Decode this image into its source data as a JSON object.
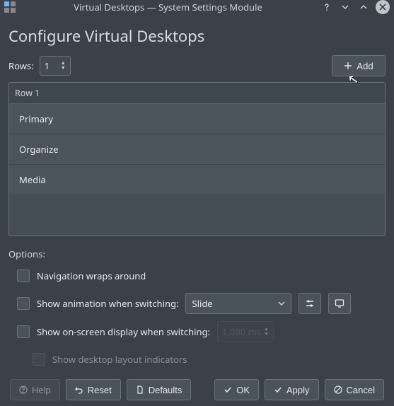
{
  "titlebar": {
    "title": "Virtual Desktops — System Settings Module"
  },
  "header": {
    "title": "Configure Virtual Desktops"
  },
  "rows": {
    "label": "Rows:",
    "value": "1",
    "add_label": "Add"
  },
  "list": {
    "row_header": "Row 1",
    "desktops": [
      "Primary",
      "Organize",
      "Media"
    ]
  },
  "options": {
    "label": "Options:",
    "nav_wrap": "Navigation wraps around",
    "show_anim": "Show animation when switching:",
    "anim_value": "Slide",
    "show_osd": "Show on-screen display when switching:",
    "osd_value": "1,000 ms",
    "layout_ind": "Show desktop layout indicators"
  },
  "buttons": {
    "help": "Help",
    "reset": "Reset",
    "defaults": "Defaults",
    "ok": "OK",
    "apply": "Apply",
    "cancel": "Cancel"
  }
}
